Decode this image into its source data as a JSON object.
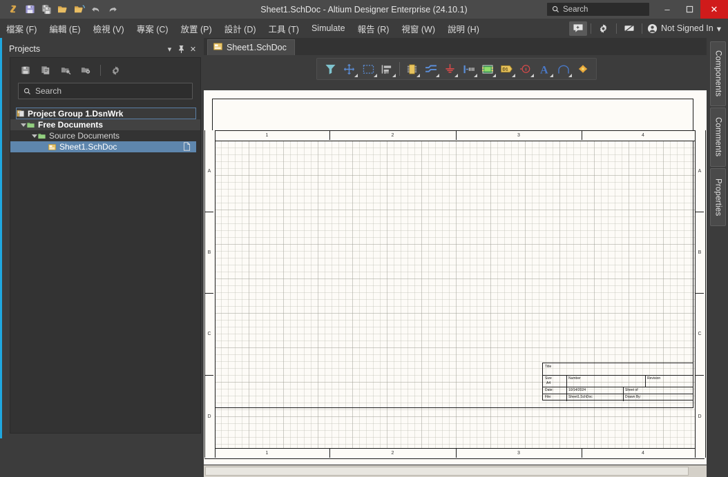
{
  "titlebar": {
    "title": "Sheet1.SchDoc - Altium Designer Enterprise (24.10.1)",
    "logo_icon": "altium-logo-icon",
    "buttons": [
      {
        "name": "save-button",
        "icon": "save-icon"
      },
      {
        "name": "save-all-button",
        "icon": "save-all-icon"
      },
      {
        "name": "open-file-button",
        "icon": "open-folder-icon"
      },
      {
        "name": "open-project-button",
        "icon": "open-project-folder-icon"
      },
      {
        "name": "undo-button",
        "icon": "undo-arrow-icon"
      },
      {
        "name": "redo-button",
        "icon": "redo-arrow-icon"
      }
    ],
    "search": {
      "placeholder": "Search",
      "icon": "search-icon"
    },
    "minimize_label": "–",
    "maximize_label": "❐",
    "close_label": "✕"
  },
  "menubar": {
    "items": [
      {
        "label": "檔案 (F)"
      },
      {
        "label": "編輯 (E)"
      },
      {
        "label": "檢視 (V)"
      },
      {
        "label": "專案 (C)"
      },
      {
        "label": "放置 (P)"
      },
      {
        "label": "設計 (D)"
      },
      {
        "label": "工具 (T)"
      },
      {
        "label": "Simulate"
      },
      {
        "label": "報告 (R)"
      },
      {
        "label": "視窗 (W)"
      },
      {
        "label": "說明 (H)"
      }
    ],
    "right": {
      "notifications_icon": "notification-badge-icon",
      "settings_icon": "gear-icon",
      "license_icon": "license-icon",
      "account_icon": "user-avatar-icon",
      "account_label": "Not Signed In",
      "account_caret": "▾"
    }
  },
  "panel": {
    "title": "Projects",
    "header_buttons": [
      {
        "name": "panel-menu-button",
        "glyph": "▾"
      },
      {
        "name": "panel-pin-button",
        "glyph": "pin-icon"
      },
      {
        "name": "panel-close-button",
        "glyph": "✕"
      }
    ],
    "toolbar": [
      {
        "name": "panel-save-button",
        "icon": "save-icon"
      },
      {
        "name": "panel-copy-button",
        "icon": "copy-documents-icon"
      },
      {
        "name": "panel-open-project-button",
        "icon": "folder-search-icon"
      },
      {
        "name": "panel-project-options-button",
        "icon": "folder-gear-icon"
      },
      {
        "name": "panel-settings-button",
        "icon": "gear-icon"
      }
    ],
    "search": {
      "placeholder": "Search",
      "icon": "search-icon"
    },
    "tree": [
      {
        "label": "Project Group 1.DsnWrk",
        "icon": "project-group-icon",
        "level": 0,
        "state": "outlined"
      },
      {
        "label": "Free Documents",
        "icon": "folder-icon",
        "level": 1,
        "state": "highlight",
        "expanded": true
      },
      {
        "label": "Source Documents",
        "icon": "folder-icon",
        "level": 2,
        "state": "normal",
        "expanded": true
      },
      {
        "label": "Sheet1.SchDoc",
        "icon": "schdoc-icon",
        "level": 3,
        "state": "selected",
        "trailing_icon": "document-icon"
      }
    ]
  },
  "editor": {
    "tab": {
      "label": "Sheet1.SchDoc",
      "icon": "schdoc-icon"
    },
    "toolbar_icons": [
      {
        "name": "filter-icon",
        "label": "filter"
      },
      {
        "name": "crosshair-icon",
        "label": "crosshair"
      },
      {
        "name": "select-area-icon",
        "label": "select-area"
      },
      {
        "name": "align-icon",
        "label": "align"
      },
      {
        "name": "place-part-icon",
        "label": "place-part"
      },
      {
        "name": "place-wire-icon",
        "label": "place-wire"
      },
      {
        "name": "place-ground-icon",
        "label": "place-ground"
      },
      {
        "name": "place-net-label-icon",
        "label": "place-net-label"
      },
      {
        "name": "place-sheet-symbol-icon",
        "label": "place-sheet-symbol"
      },
      {
        "name": "place-port-icon",
        "label": "D1"
      },
      {
        "name": "place-no-erc-icon",
        "label": "place-no-erc"
      },
      {
        "name": "place-text-icon",
        "label": "A"
      },
      {
        "name": "place-arc-icon",
        "label": "place-arc"
      },
      {
        "name": "place-directive-icon",
        "label": "place-directive"
      }
    ]
  },
  "sheet": {
    "columns": [
      "1",
      "2",
      "3",
      "4"
    ],
    "rows": [
      "A",
      "B",
      "C",
      "D"
    ],
    "titleblock": {
      "title_label": "Title",
      "title_value": "",
      "size_label": "Size",
      "size_value": "A4",
      "number_label": "Number",
      "number_value": "",
      "revision_label": "Revision",
      "revision_value": "",
      "date_label": "Date:",
      "date_value": "10/14/2024",
      "sheet_label": "Sheet   of",
      "file_label": "File:",
      "file_value": "Sheet1.SchDoc",
      "drawn_label": "Drawn By:"
    }
  },
  "right_tabs": [
    {
      "label": "Components"
    },
    {
      "label": "Comments"
    },
    {
      "label": "Properties"
    }
  ]
}
